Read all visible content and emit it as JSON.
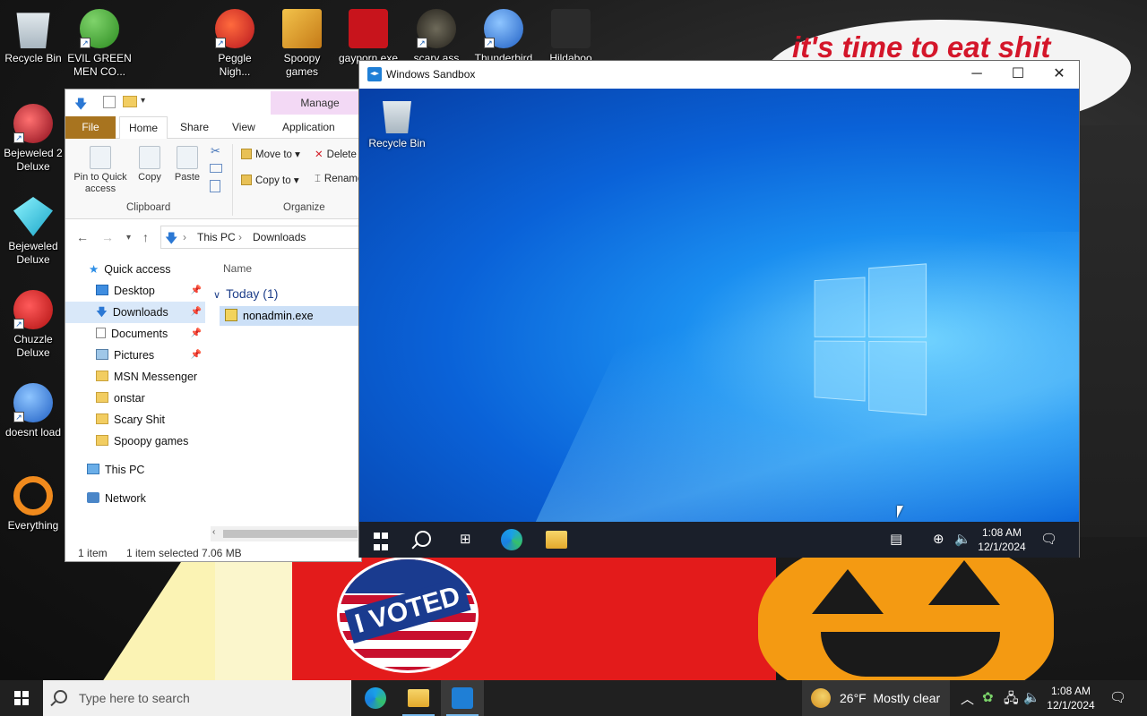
{
  "wallpaper": {
    "note_text": "it's time to eat shit",
    "sticker_text": "I VOTED"
  },
  "desktop_icons": [
    {
      "label": "Recycle Bin"
    },
    {
      "label": "EVIL GREEN MEN CO..."
    },
    {
      "label": "Peggle Nigh..."
    },
    {
      "label": "Spoopy games"
    },
    {
      "label": "gayporn.exe"
    },
    {
      "label": "scary ass"
    },
    {
      "label": "Thunderbird"
    },
    {
      "label": "Hildaboo"
    },
    {
      "label": "Bejeweled 2 Deluxe"
    },
    {
      "label": "Bejeweled Deluxe"
    },
    {
      "label": "Chuzzle Deluxe"
    },
    {
      "label": "doesnt load"
    },
    {
      "label": "Everything"
    }
  ],
  "explorer": {
    "contextual_tab": "Manage",
    "tabs": [
      "File",
      "Home",
      "Share",
      "View",
      "Application Tools"
    ],
    "ribbon": {
      "pin": "Pin to Quick access",
      "copy": "Copy",
      "paste": "Paste",
      "move_to": "Move to",
      "copy_to": "Copy to",
      "delete": "Delete",
      "rename": "Rename",
      "group_clipboard": "Clipboard",
      "group_organize": "Organize"
    },
    "breadcrumb": [
      "This PC",
      "Downloads"
    ],
    "nav": [
      {
        "label": "Quick access"
      },
      {
        "label": "Desktop"
      },
      {
        "label": "Downloads"
      },
      {
        "label": "Documents"
      },
      {
        "label": "Pictures"
      },
      {
        "label": "MSN Messenger"
      },
      {
        "label": "onstar"
      },
      {
        "label": "Scary Shit"
      },
      {
        "label": "Spoopy games"
      },
      {
        "label": "This PC"
      },
      {
        "label": "Network"
      }
    ],
    "column_name": "Name",
    "group_header": "Today (1)",
    "files": [
      {
        "name": "nonadmin.exe"
      }
    ],
    "status": {
      "items": "1 item",
      "selected": "1 item selected",
      "size": "7.06 MB"
    }
  },
  "sandbox": {
    "title": "Windows Sandbox",
    "desktop_icon": "Recycle Bin",
    "clock_time": "1:08 AM",
    "clock_date": "12/1/2024"
  },
  "taskbar": {
    "search_placeholder": "Type here to search",
    "weather_temp": "26°F",
    "weather_desc": "Mostly clear",
    "clock_time": "1:08 AM",
    "clock_date": "12/1/2024"
  },
  "colors": {
    "accent": "#0078d7",
    "file_tab": "#a8741f",
    "selection": "#cce0f7",
    "taskbar": "#202020"
  }
}
